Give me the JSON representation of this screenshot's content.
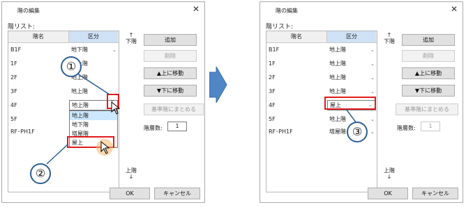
{
  "dialog": {
    "title": "階の編集",
    "close_glyph": "✕",
    "list_label": "階リスト:",
    "col_floor_name": "階名",
    "col_category": "区分",
    "floor_names": [
      "B1F",
      "1F",
      "2F",
      "3F",
      "4F",
      "5F",
      "RF･PH1F"
    ],
    "buttons": {
      "add": "追加",
      "delete": "削除",
      "move_up": "▲上に移動",
      "move_down": "▼下に移動",
      "merge_base": "基準階にまとめる",
      "ok": "OK",
      "cancel": "キャンセル"
    },
    "side_top_arrow": "↑",
    "side_top": "下階",
    "side_bottom": "上階",
    "side_bottom_arrow": "↓",
    "floor_count_label": "階層数:",
    "floor_count_value": "1",
    "dropdown_glyph": "⌄"
  },
  "before": {
    "categories": [
      "地下階",
      "地上階",
      "地上階",
      "地上階",
      "地上階",
      "",
      "塔屋階"
    ],
    "edit_value": "地上階",
    "dropdown_options": [
      "地上階",
      "地下階",
      "塔屋階",
      "屋上"
    ],
    "highlighted_option": "地上階",
    "callout_1": "①",
    "callout_2": "②"
  },
  "after": {
    "categories": [
      "地上階",
      "地上階",
      "地上階",
      "地上階",
      "屋上",
      "地上階",
      "塔屋階"
    ],
    "edit_value": "屋上",
    "callout_3": "③"
  },
  "colors": {
    "red_highlight": "#e21a1a",
    "arrow_fill": "#4f86c6",
    "callout_border": "#2c5f93",
    "selection": "#cce8ff"
  }
}
